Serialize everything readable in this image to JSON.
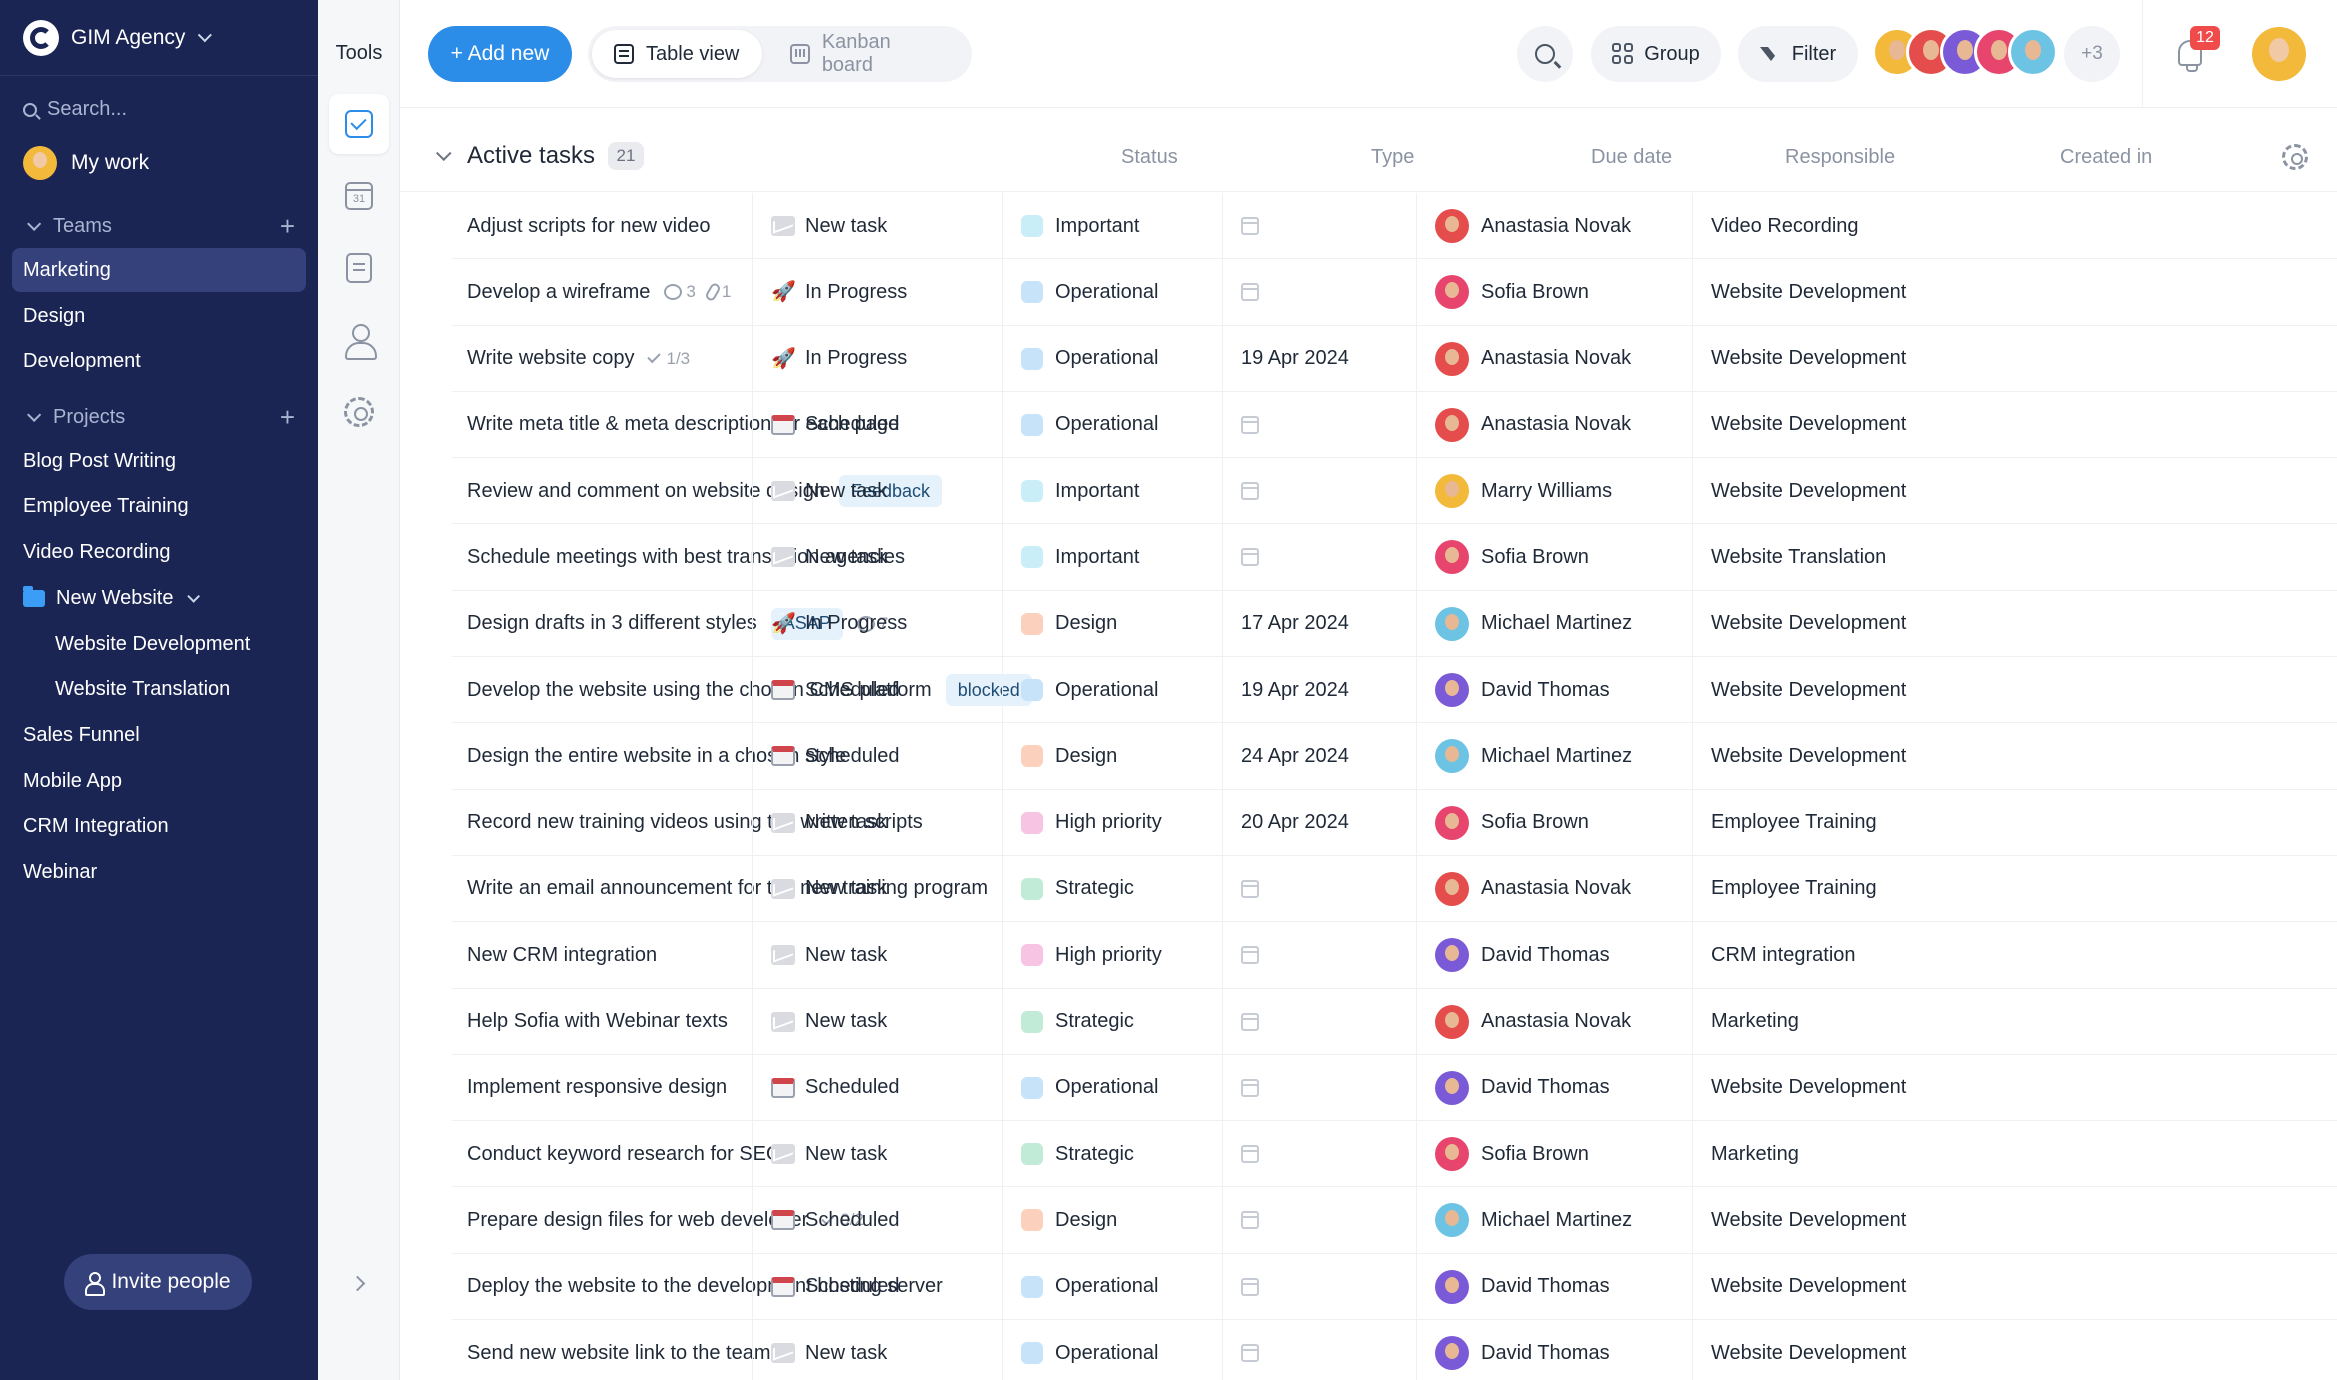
{
  "workspace": {
    "name": "GIM Agency"
  },
  "sidebar": {
    "search_placeholder": "Search...",
    "my_work": "My work",
    "teams_label": "Teams",
    "teams": [
      "Marketing",
      "Design",
      "Development"
    ],
    "active_team": "Marketing",
    "projects_label": "Projects",
    "projects": [
      "Blog Post Writing",
      "Employee Training",
      "Video Recording"
    ],
    "folder": {
      "name": "New Website",
      "children": [
        "Website Development",
        "Website Translation"
      ]
    },
    "projects_after": [
      "Sales Funnel",
      "Mobile App",
      "CRM Integration",
      "Webinar"
    ],
    "invite_label": "Invite people"
  },
  "tools": {
    "title": "Tools",
    "items": [
      "tasks-icon",
      "calendar-icon",
      "document-icon",
      "contacts-icon",
      "settings-icon"
    ],
    "calendar_day": "31"
  },
  "toolbar": {
    "add_label": "+ Add new",
    "views": [
      {
        "label": "Table view",
        "active": true
      },
      {
        "label": "Kanban board",
        "active": false
      }
    ],
    "group_label": "Group",
    "filter_label": "Filter",
    "extra_members": "+3",
    "notifications": "12"
  },
  "colors": {
    "accent": "#2b8de8",
    "sidebar_bg": "#1a2553",
    "badge": "#f04b4b"
  },
  "table": {
    "group_title": "Active tasks",
    "group_count": "21",
    "columns": [
      "Status",
      "Type",
      "Due date",
      "Responsible",
      "Created in"
    ],
    "rows": [
      {
        "task": "Adjust scripts for new video",
        "status": "New task",
        "type": "Important",
        "due": "",
        "resp": "Anastasia Novak",
        "created": "Video Recording"
      },
      {
        "task": "Develop a wireframe",
        "comments": "3",
        "attachments": "1",
        "status": "In Progress",
        "type": "Operational",
        "due": "",
        "resp": "Sofia Brown",
        "created": "Website Development"
      },
      {
        "task": "Write website copy",
        "checklist": "1/3",
        "status": "In Progress",
        "type": "Operational",
        "due": "19 Apr 2024",
        "resp": "Anastasia Novak",
        "created": "Website Development"
      },
      {
        "task": "Write meta title & meta description for each page",
        "status": "Scheduled",
        "type": "Operational",
        "due": "",
        "resp": "Anastasia Novak",
        "created": "Website Development"
      },
      {
        "task": "Review and comment on website design",
        "tag": "Feedback",
        "status": "New task",
        "type": "Important",
        "due": "",
        "resp": "Marry Williams",
        "created": "Website Development"
      },
      {
        "task": "Schedule meetings with best translation agencies",
        "status": "New task",
        "type": "Important",
        "due": "",
        "resp": "Sofia Brown",
        "created": "Website Translation"
      },
      {
        "task": "Design drafts in 3 different styles",
        "tag": "ASAP",
        "comments": "7",
        "status": "In Progress",
        "type": "Design",
        "due": "17 Apr 2024",
        "resp": "Michael Martinez",
        "created": "Website Development"
      },
      {
        "task": "Develop the website using the chosen CMS platform",
        "tag": "blocked",
        "status": "Scheduled",
        "type": "Operational",
        "due": "19 Apr 2024",
        "resp": "David Thomas",
        "created": "Website Development"
      },
      {
        "task": "Design the entire website in a chosen style",
        "status": "Scheduled",
        "type": "Design",
        "due": "24 Apr 2024",
        "resp": "Michael Martinez",
        "created": "Website Development"
      },
      {
        "task": "Record new training videos using the written scripts",
        "status": "New task",
        "type": "High priority",
        "due": "20 Apr 2024",
        "resp": "Sofia Brown",
        "created": "Employee Training"
      },
      {
        "task": "Write an email announcement for the new training program",
        "status": "New task",
        "type": "Strategic",
        "due": "",
        "resp": "Anastasia Novak",
        "created": "Employee Training"
      },
      {
        "task": "New CRM integration",
        "status": "New task",
        "type": "High priority",
        "due": "",
        "resp": "David Thomas",
        "created": "CRM integration"
      },
      {
        "task": "Help Sofia with Webinar texts",
        "status": "New task",
        "type": "Strategic",
        "due": "",
        "resp": "Anastasia Novak",
        "created": "Marketing"
      },
      {
        "task": "Implement responsive design",
        "status": "Scheduled",
        "type": "Operational",
        "due": "",
        "resp": "David Thomas",
        "created": "Website Development"
      },
      {
        "task": "Conduct keyword research for SEO",
        "status": "New task",
        "type": "Strategic",
        "due": "",
        "resp": "Sofia Brown",
        "created": "Marketing"
      },
      {
        "task": "Prepare design files for web developer",
        "checklist": "0/2",
        "status": "Scheduled",
        "type": "Design",
        "due": "",
        "resp": "Michael Martinez",
        "created": "Website Development"
      },
      {
        "task": "Deploy the website to the development hosting server",
        "status": "Scheduled",
        "type": "Operational",
        "due": "",
        "resp": "David Thomas",
        "created": "Website Development"
      },
      {
        "task": "Send new website link to the team",
        "status": "New task",
        "type": "Operational",
        "due": "",
        "resp": "David Thomas",
        "created": "Website Development"
      }
    ]
  },
  "type_colors": {
    "Important": "#c9eef7",
    "Operational": "#c6e3f9",
    "Design": "#fbd1bd",
    "High priority": "#f7c4e4",
    "Strategic": "#c1ebd6"
  },
  "person_colors": {
    "Anastasia Novak": "#e54c4c",
    "Sofia Brown": "#e8456e",
    "Marry Williams": "#f2b93a",
    "Michael Martinez": "#6cc3e3",
    "David Thomas": "#7b5ad8"
  },
  "team_colors": [
    "#f2b93a",
    "#e54c4c",
    "#7b5ad8",
    "#e8456e",
    "#6cc3e3"
  ]
}
